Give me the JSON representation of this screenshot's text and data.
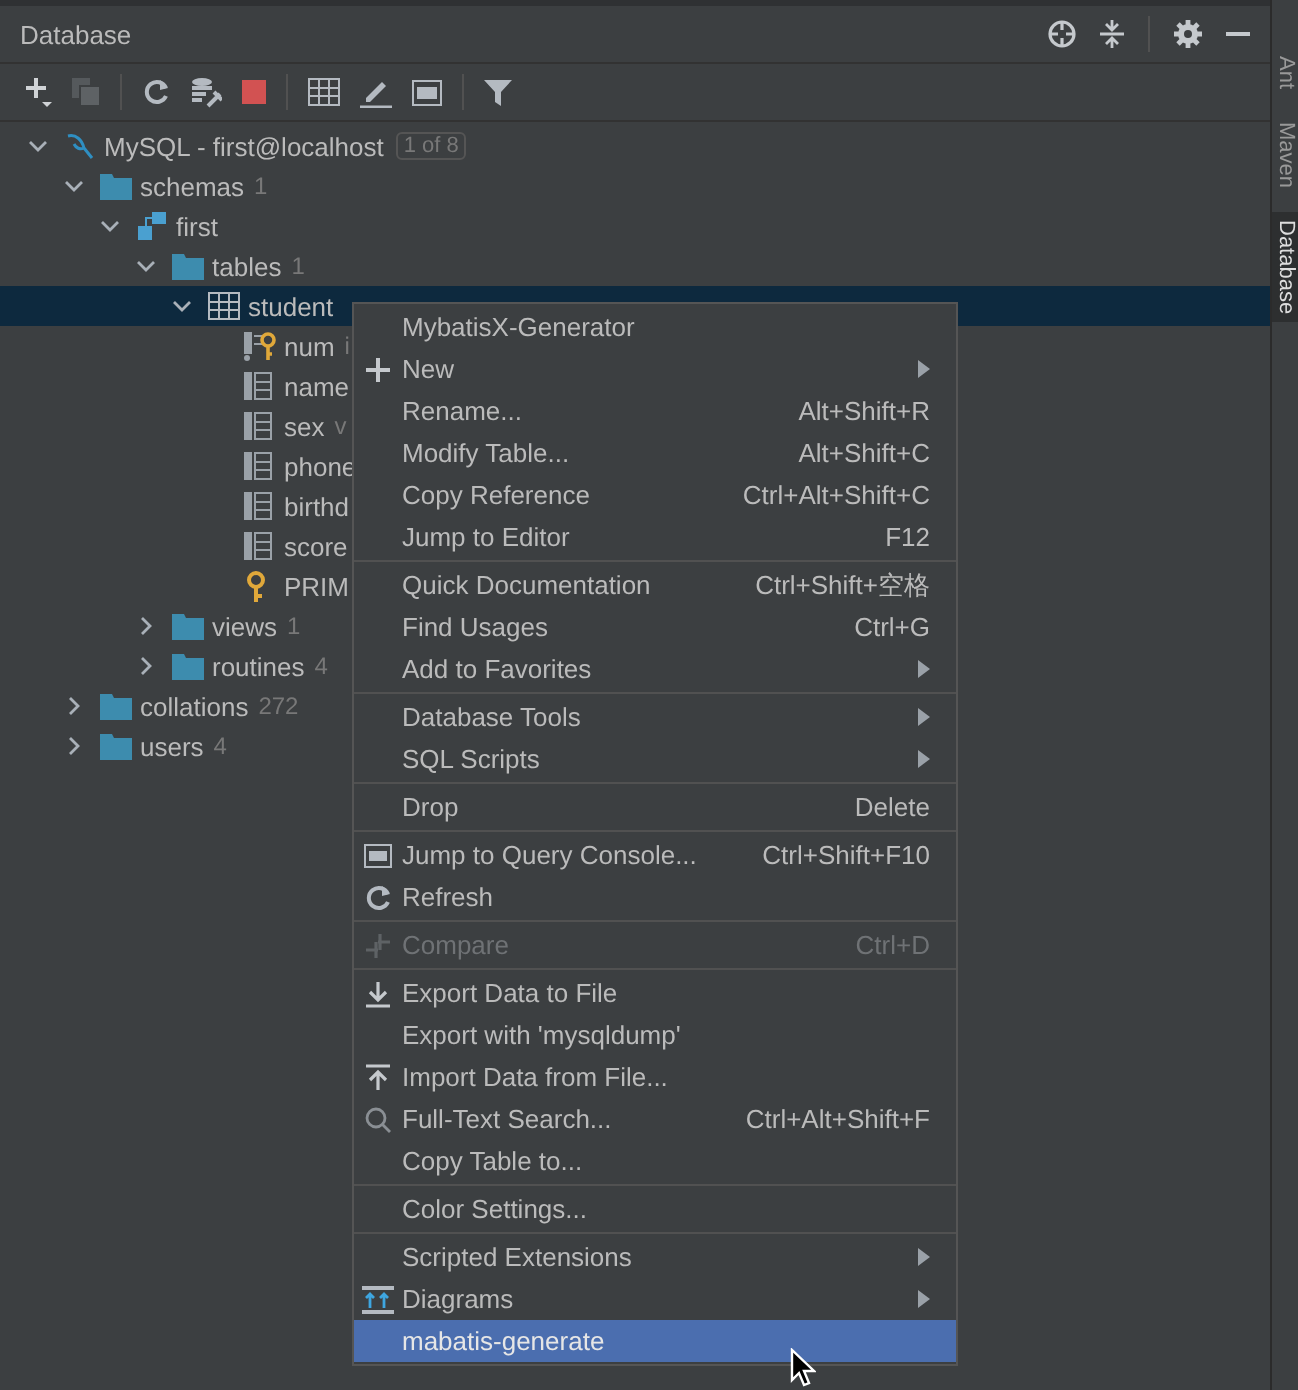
{
  "panel": {
    "title": "Database"
  },
  "side_tabs": [
    {
      "label": "Ant",
      "selected": false
    },
    {
      "label": "Maven",
      "selected": false
    },
    {
      "label": "Database",
      "selected": true
    }
  ],
  "tree": [
    {
      "kind": "connection",
      "label": "MySQL - first@localhost",
      "badge": "1 of 8",
      "expanded": true,
      "selected": false,
      "children": [
        {
          "kind": "folder",
          "label": "schemas",
          "count": "1",
          "expanded": true,
          "selected": false,
          "children": [
            {
              "kind": "schema",
              "label": "first",
              "expanded": true,
              "selected": false,
              "children": [
                {
                  "kind": "folder",
                  "label": "tables",
                  "count": "1",
                  "expanded": true,
                  "selected": false,
                  "children": [
                    {
                      "kind": "table",
                      "label": "student",
                      "expanded": true,
                      "selected": true,
                      "children": [
                        {
                          "kind": "key-column",
                          "label": "num",
                          "detail": "i",
                          "selected": false
                        },
                        {
                          "kind": "column",
                          "label": "name",
                          "selected": false
                        },
                        {
                          "kind": "column",
                          "label": "sex",
                          "detail": "v",
                          "selected": false
                        },
                        {
                          "kind": "column",
                          "label": "phone",
                          "selected": false
                        },
                        {
                          "kind": "column",
                          "label": "birthd",
                          "selected": false
                        },
                        {
                          "kind": "column",
                          "label": "score",
                          "selected": false
                        },
                        {
                          "kind": "key",
                          "label": "PRIM",
                          "selected": false
                        }
                      ]
                    }
                  ]
                },
                {
                  "kind": "folder",
                  "label": "views",
                  "count": "1",
                  "expanded": false,
                  "selected": false
                },
                {
                  "kind": "folder",
                  "label": "routines",
                  "count": "4",
                  "expanded": false,
                  "selected": false
                }
              ]
            }
          ]
        },
        {
          "kind": "folder",
          "label": "collations",
          "count": "272",
          "expanded": false,
          "selected": false
        },
        {
          "kind": "folder",
          "label": "users",
          "count": "4",
          "expanded": false,
          "selected": false
        }
      ]
    }
  ],
  "context_menu": [
    {
      "kind": "item",
      "label": "MybatisX-Generator",
      "disabled": false,
      "selected": false,
      "submenu": false
    },
    {
      "kind": "item",
      "label": "New",
      "disabled": false,
      "selected": false,
      "submenu": true
    },
    {
      "kind": "item",
      "label": "Rename...",
      "shortcut": "Alt+Shift+R",
      "disabled": false,
      "selected": false,
      "submenu": false
    },
    {
      "kind": "item",
      "label": "Modify Table...",
      "shortcut": "Alt+Shift+C",
      "disabled": false,
      "selected": false,
      "submenu": false
    },
    {
      "kind": "item",
      "label": "Copy Reference",
      "shortcut": "Ctrl+Alt+Shift+C",
      "disabled": false,
      "selected": false,
      "submenu": false
    },
    {
      "kind": "item",
      "label": "Jump to Editor",
      "shortcut": "F12",
      "disabled": false,
      "selected": false,
      "submenu": false
    },
    {
      "kind": "separator"
    },
    {
      "kind": "item",
      "label": "Quick Documentation",
      "shortcut": "Ctrl+Shift+空格",
      "disabled": false,
      "selected": false,
      "submenu": false
    },
    {
      "kind": "item",
      "label": "Find Usages",
      "shortcut": "Ctrl+G",
      "disabled": false,
      "selected": false,
      "submenu": false
    },
    {
      "kind": "item",
      "label": "Add to Favorites",
      "disabled": false,
      "selected": false,
      "submenu": true
    },
    {
      "kind": "separator"
    },
    {
      "kind": "item",
      "label": "Database Tools",
      "disabled": false,
      "selected": false,
      "submenu": true
    },
    {
      "kind": "item",
      "label": "SQL Scripts",
      "disabled": false,
      "selected": false,
      "submenu": true
    },
    {
      "kind": "separator"
    },
    {
      "kind": "item",
      "label": "Drop",
      "shortcut": "Delete",
      "disabled": false,
      "selected": false,
      "submenu": false
    },
    {
      "kind": "separator"
    },
    {
      "kind": "item",
      "label": "Jump to Query Console...",
      "shortcut": "Ctrl+Shift+F10",
      "disabled": false,
      "selected": false,
      "submenu": false
    },
    {
      "kind": "item",
      "label": "Refresh",
      "disabled": false,
      "selected": false,
      "submenu": false
    },
    {
      "kind": "separator"
    },
    {
      "kind": "item",
      "label": "Compare",
      "shortcut": "Ctrl+D",
      "disabled": true,
      "selected": false,
      "submenu": false
    },
    {
      "kind": "separator"
    },
    {
      "kind": "item",
      "label": "Export Data to File",
      "disabled": false,
      "selected": false,
      "submenu": false
    },
    {
      "kind": "item",
      "label": "Export with 'mysqldump'",
      "disabled": false,
      "selected": false,
      "submenu": false
    },
    {
      "kind": "item",
      "label": "Import Data from File...",
      "disabled": false,
      "selected": false,
      "submenu": false
    },
    {
      "kind": "item",
      "label": "Full-Text Search...",
      "shortcut": "Ctrl+Alt+Shift+F",
      "disabled": false,
      "selected": false,
      "submenu": false
    },
    {
      "kind": "item",
      "label": "Copy Table to...",
      "disabled": false,
      "selected": false,
      "submenu": false
    },
    {
      "kind": "separator"
    },
    {
      "kind": "item",
      "label": "Color Settings...",
      "disabled": false,
      "selected": false,
      "submenu": false
    },
    {
      "kind": "separator"
    },
    {
      "kind": "item",
      "label": "Scripted Extensions",
      "disabled": false,
      "selected": false,
      "submenu": true
    },
    {
      "kind": "item",
      "label": "Diagrams",
      "disabled": false,
      "selected": false,
      "submenu": true
    },
    {
      "kind": "item",
      "label": "mabatis-generate",
      "disabled": false,
      "selected": true,
      "submenu": false
    }
  ]
}
